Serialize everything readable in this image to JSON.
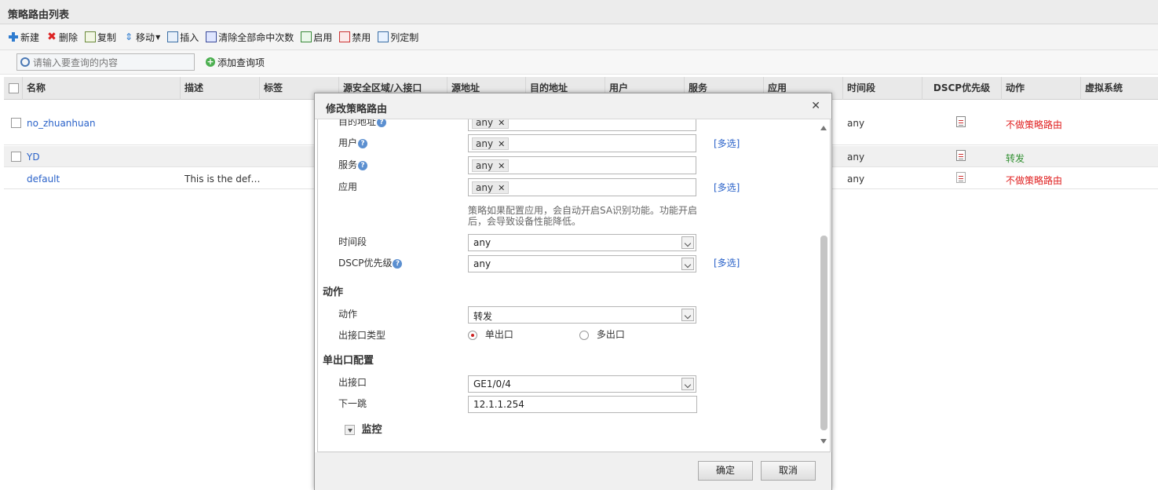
{
  "page": {
    "title": "策略路由列表"
  },
  "toolbar": {
    "new": "新建",
    "delete": "删除",
    "copy": "复制",
    "move": "移动",
    "insert": "插入",
    "clear_hits": "清除全部命中次数",
    "enable": "启用",
    "disable": "禁用",
    "columns": "列定制"
  },
  "search": {
    "placeholder": "请输入要查询的内容",
    "add_query": "添加查询项"
  },
  "grid": {
    "headers": [
      "名称",
      "描述",
      "标签",
      "源安全区域/入接口",
      "源地址",
      "目的地址",
      "用户",
      "服务",
      "应用",
      "时间段",
      "DSCP优先级",
      "动作",
      "虚拟系统"
    ],
    "rows": [
      {
        "name": "no_zhuanhuan",
        "desc": "",
        "time": "any",
        "action": "不做策略路由"
      },
      {
        "name": "YD",
        "desc": "",
        "time": "any",
        "action": "转发"
      },
      {
        "name": "default",
        "desc": "This is the def…",
        "time": "any",
        "action": "不做策略路由"
      }
    ]
  },
  "dialog": {
    "title": "修改策略路由",
    "dest_label": "目的地址",
    "dest_value": "any",
    "user_label": "用户",
    "user_value": "any",
    "service_label": "服务",
    "service_value": "any",
    "app_label": "应用",
    "app_value": "any",
    "multi": "[多选]",
    "app_note": "策略如果配置应用，会自动开启SA识别功能。功能开启后，会导致设备性能降低。",
    "time_label": "时间段",
    "time_value": "any",
    "dscp_label": "DSCP优先级",
    "dscp_value": "any",
    "action_section": "动作",
    "action_label": "动作",
    "action_value": "转发",
    "out_type_label": "出接口类型",
    "single_out": "单出口",
    "multi_out": "多出口",
    "single_section": "单出口配置",
    "out_if_label": "出接口",
    "out_if_value": "GE1/0/4",
    "next_hop_label": "下一跳",
    "next_hop_value": "12.1.1.254",
    "monitor_label": "监控",
    "ok": "确定",
    "cancel": "取消"
  },
  "colors": {
    "link": "#2a62c9",
    "red": "#e02020",
    "green": "#2f8f2f"
  }
}
